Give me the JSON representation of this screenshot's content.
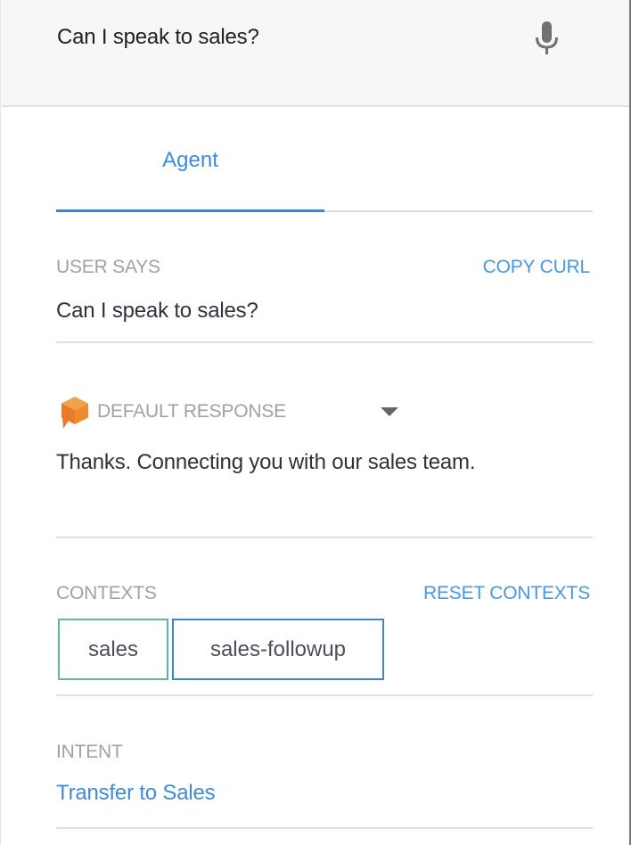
{
  "query": {
    "text": "Can I speak to sales?",
    "mic_icon": "microphone-icon"
  },
  "tabs": [
    {
      "label": "Agent",
      "active": true
    }
  ],
  "user_says": {
    "label": "USER SAYS",
    "action": "COPY CURL",
    "value": "Can I speak to sales?"
  },
  "response": {
    "logo_icon": "dialogflow-cube-icon",
    "label": "DEFAULT RESPONSE",
    "dropdown_icon": "caret-down-icon",
    "text": "Thanks. Connecting you with our sales team."
  },
  "contexts": {
    "label": "CONTEXTS",
    "action": "RESET CONTEXTS",
    "items": [
      {
        "name": "sales",
        "color": "#5fb89a"
      },
      {
        "name": "sales-followup",
        "color": "#3a86d6"
      }
    ]
  },
  "intent": {
    "label": "INTENT",
    "value": "Transfer to Sales"
  },
  "colors": {
    "accent": "#3e8bd8",
    "label_gray": "#9da1a9",
    "logo_orange": "#ef8a2f"
  }
}
